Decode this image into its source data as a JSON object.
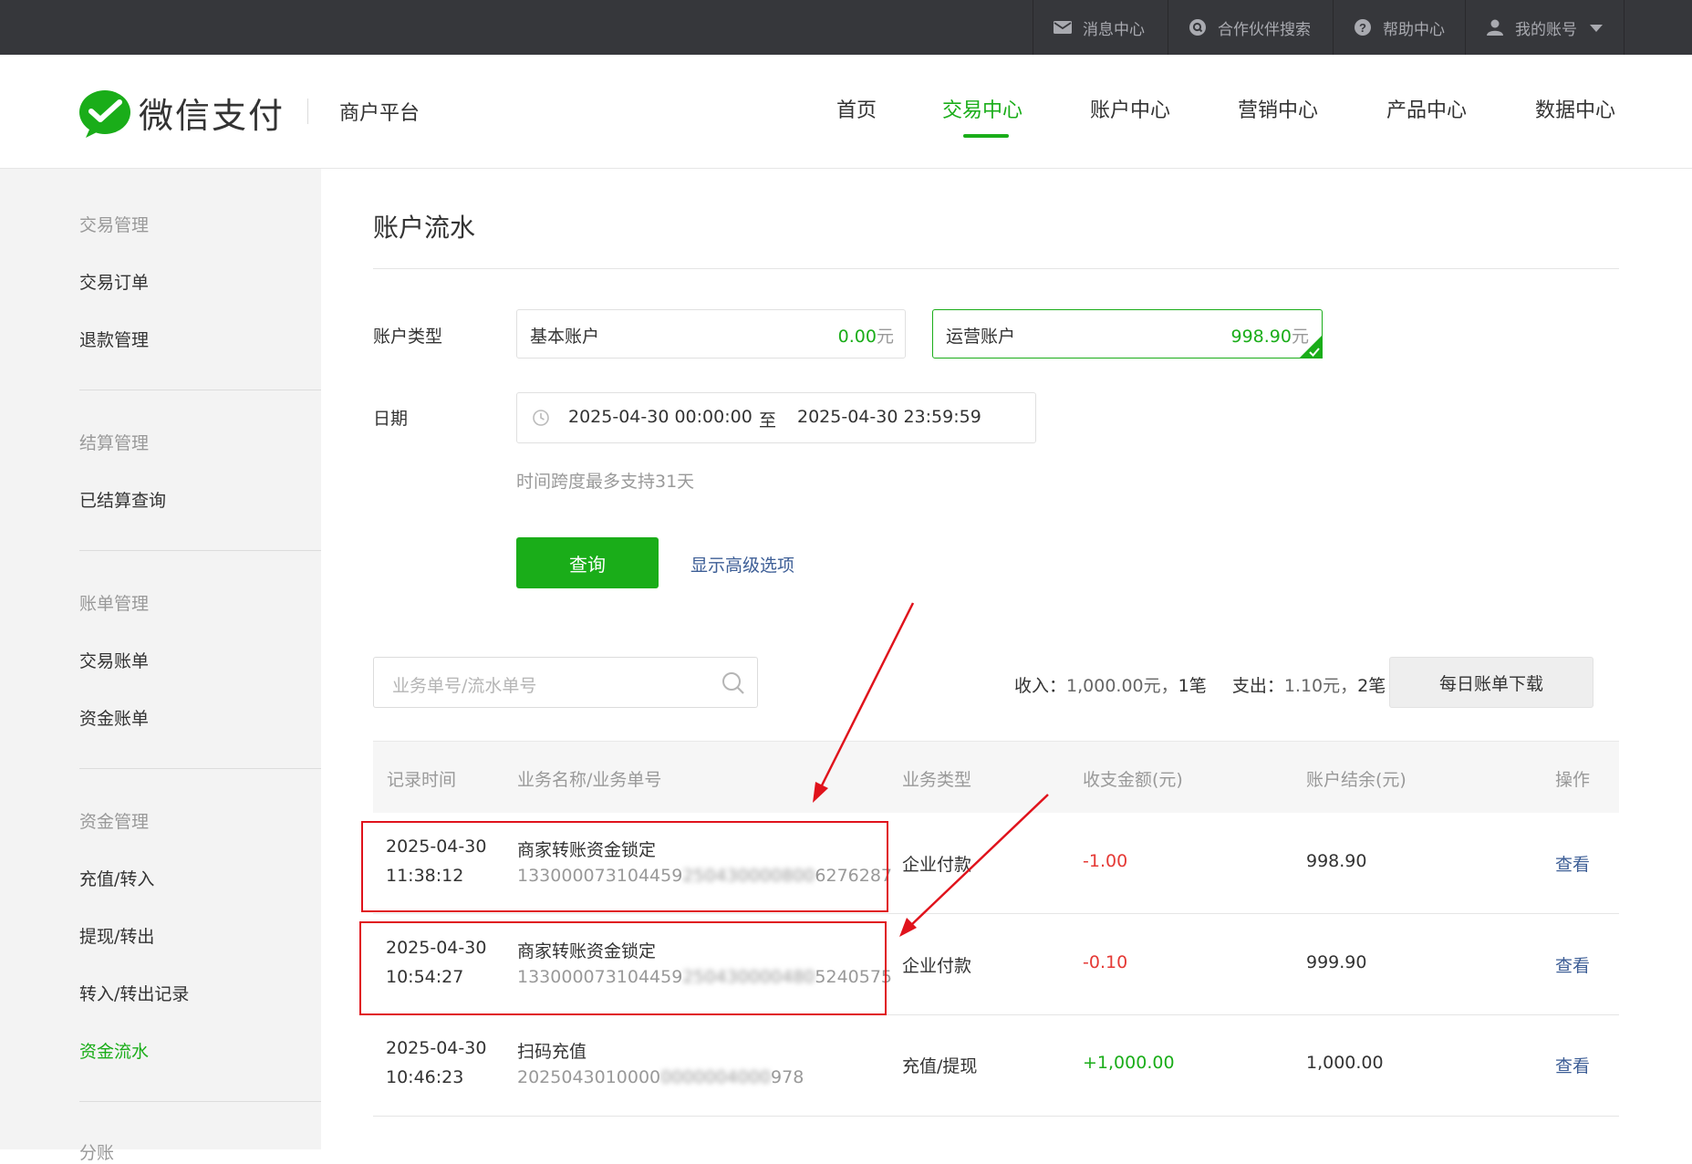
{
  "topbar": {
    "items": [
      {
        "label": "消息中心",
        "icon": "mail-icon"
      },
      {
        "label": "合作伙伴搜索",
        "icon": "partner-search-icon"
      },
      {
        "label": "帮助中心",
        "icon": "help-icon"
      },
      {
        "label": "我的账号",
        "icon": "user-icon"
      }
    ]
  },
  "header": {
    "brand": "微信支付",
    "subtitle": "商户平台",
    "nav": [
      "首页",
      "交易中心",
      "账户中心",
      "营销中心",
      "产品中心",
      "数据中心"
    ],
    "active_nav": "交易中心"
  },
  "sidebar": {
    "groups": [
      {
        "title": "交易管理",
        "items": [
          "交易订单",
          "退款管理"
        ]
      },
      {
        "title": "结算管理",
        "items": [
          "已结算查询"
        ]
      },
      {
        "title": "账单管理",
        "items": [
          "交易账单",
          "资金账单"
        ]
      },
      {
        "title": "资金管理",
        "items": [
          "充值/转入",
          "提现/转出",
          "转入/转出记录",
          "资金流水"
        ]
      },
      {
        "title": "分账"
      }
    ],
    "active_item": "资金流水"
  },
  "main": {
    "title": "账户流水",
    "account_type_label": "账户类型",
    "accounts": [
      {
        "name": "基本账户",
        "amount": "0.00",
        "unit": "元",
        "selected": false
      },
      {
        "name": "运营账户",
        "amount": "998.90",
        "unit": "元",
        "selected": true
      }
    ],
    "date_label": "日期",
    "date_from": "2025-04-30 00:00:00",
    "date_sep": "至",
    "date_to": "2025-04-30 23:59:59",
    "date_hint": "时间跨度最多支持31天",
    "query_button": "查询",
    "advanced_link": "显示高级选项",
    "search_placeholder": "业务单号/流水单号",
    "summary": {
      "income_label": "收入：",
      "income_value": "1,000.00元，",
      "income_count": "1笔",
      "expense_label": "支出：",
      "expense_value": "1.10元，",
      "expense_count": "2笔"
    },
    "download_button": "每日账单下载",
    "table": {
      "headers": [
        "记录时间",
        "业务名称/业务单号",
        "业务类型",
        "收支金额(元)",
        "账户结余(元)",
        "操作"
      ],
      "rows": [
        {
          "date": "2025-04-30",
          "time": "11:38:12",
          "name": "商家转账资金锁定",
          "no_head": "133000073104459",
          "no_mid": "250430000800",
          "no_tail": "6276287",
          "type": "企业付款",
          "amount": "-1.00",
          "balance": "998.90",
          "action": "查看"
        },
        {
          "date": "2025-04-30",
          "time": "10:54:27",
          "name": "商家转账资金锁定",
          "no_head": "133000073104459",
          "no_mid": "250430000480",
          "no_tail": "5240575",
          "type": "企业付款",
          "amount": "-0.10",
          "balance": "999.90",
          "action": "查看"
        },
        {
          "date": "2025-04-30",
          "time": "10:46:23",
          "name": "扫码充值",
          "no_head": "2025043010000",
          "no_mid": "0000004000",
          "no_tail": "978",
          "type": "充值/提现",
          "amount": "+1,000.00",
          "balance": "1,000.00",
          "action": "查看"
        }
      ]
    }
  },
  "colors": {
    "topbar": "#36373b",
    "brand_green": "#1aad19",
    "link_blue": "#3d5e96",
    "negative_red": "#e53935",
    "annotation_red": "#e0131c"
  }
}
